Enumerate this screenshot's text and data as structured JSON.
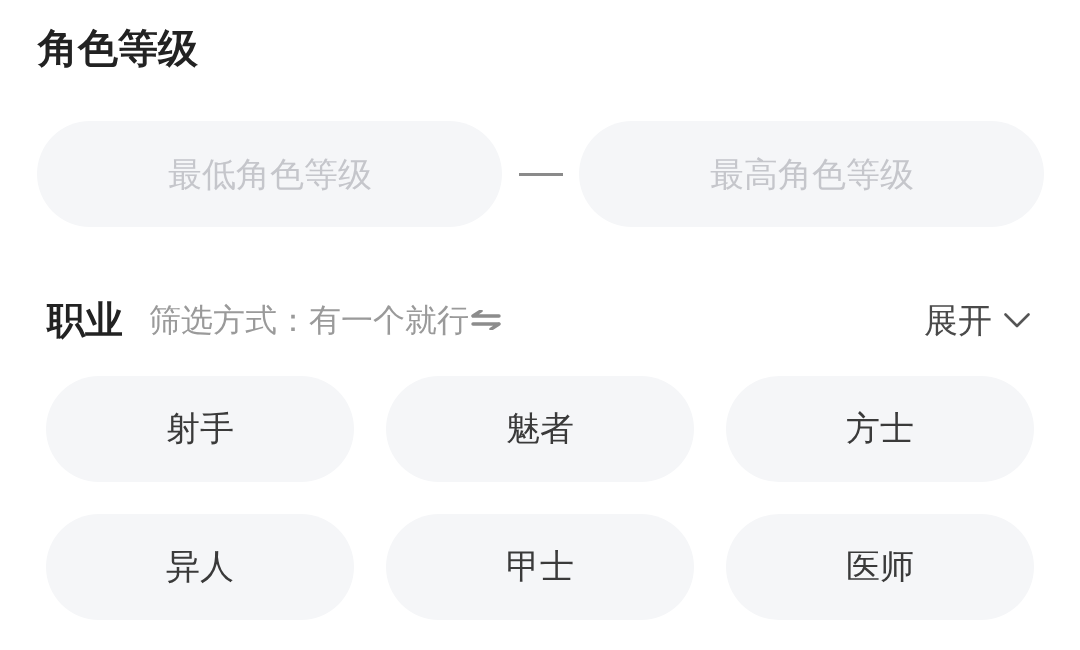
{
  "level_filter": {
    "title": "角色等级",
    "min_field": {
      "placeholder": "最低角色等级"
    },
    "max_field": {
      "placeholder": "最高角色等级"
    }
  },
  "profession": {
    "title": "职业",
    "filter_label": "筛选方式：",
    "filter_mode": "有一个就行",
    "toggle": {
      "label": "展开",
      "expanded": false
    },
    "options": [
      {
        "label": "射手",
        "selected": false
      },
      {
        "label": "魅者",
        "selected": false
      },
      {
        "label": "方士",
        "selected": false
      },
      {
        "label": "异人",
        "selected": false
      },
      {
        "label": "甲士",
        "selected": false
      },
      {
        "label": "医师",
        "selected": false
      }
    ]
  }
}
